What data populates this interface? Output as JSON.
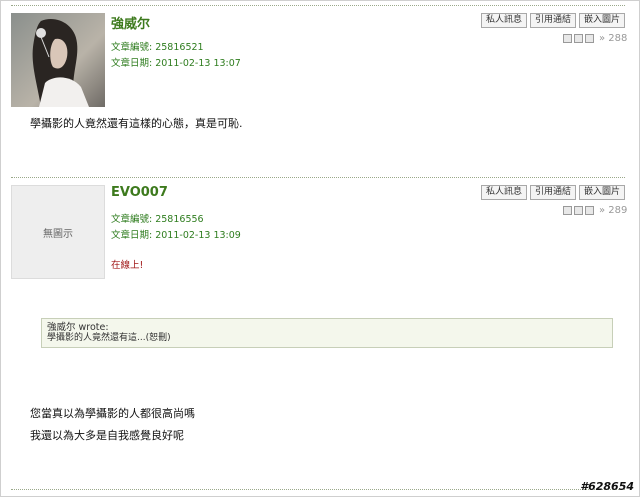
{
  "post1": {
    "username": "強威尔",
    "post_id_line": "文章編號: 25816521",
    "date_line": "文章日期: 2011-02-13 13:07",
    "buttons": [
      "私人訊息",
      "引用通結",
      "嵌入圖片"
    ],
    "post_no": "» 288",
    "body": "學攝影的人竟然還有這樣的心態，真是可恥."
  },
  "post2": {
    "username": "EVO007",
    "avatar_label": "無圖示",
    "post_id_line": "文章編號: 25816556",
    "date_line": "文章日期: 2011-02-13 13:09",
    "status": "在線上!",
    "buttons": [
      "私人訊息",
      "引用通結",
      "嵌入圖片"
    ],
    "post_no": "» 289",
    "quote": {
      "author": "強威尔 wrote:",
      "text": "學攝影的人竟然還有這...(恕刪)"
    },
    "body_lines": [
      "您當真以為學攝影的人都很高尚嗎",
      "我還以為大多是自我感覺良好呢"
    ]
  },
  "watermark": "#628654"
}
